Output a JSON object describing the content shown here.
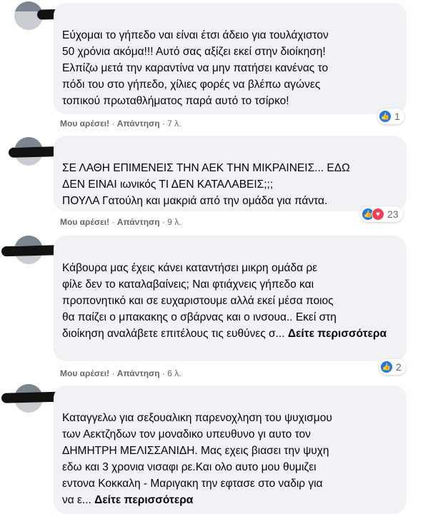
{
  "comments": [
    {
      "text": "Εύχομαι το γήπεδο ναι είναι έτσι άδειο για τουλάχιστον\n50 χρόνια ακόμα!!! Αυτό σας αξίζει εκεί στην διοίκηση!\nΕλπίζω μετά την καραντίνα να μην πατήσει κανένας το\nπόδι του στο γήπεδο, χίλιες φορές να βλέπω αγώνες\nτοπικού πρωταθλήματος παρά αυτό το τσίρκο!",
      "like_label": "Μου αρέσει!",
      "reply_label": "Απάντηση",
      "time": "7 λ.",
      "reaction_count": "1",
      "reactions": [
        "like-icon"
      ]
    },
    {
      "text": "ΣΕ ΛΑΘΗ ΕΠΙΜΕΝΕΙΣ ΤΗΝ ΑΕΚ ΤΗΝ ΜΙΚΡΑΙΝΕΙΣ... ΕΔΩ\nΔΕΝ ΕΙΝΑΙ ιωνικός ΤΙ ΔΕΝ ΚΑΤΑΛΑΒΕΙΣ;;;\nΠΟΥΛΑ Γατούλη και μακριά από την ομάδα για πάντα.",
      "like_label": "Μου αρέσει!",
      "reply_label": "Απάντηση",
      "time": "9 λ.",
      "reaction_count": "23",
      "reactions": [
        "like-icon",
        "love-icon"
      ]
    },
    {
      "text": "Κάβουρα μας έχεις κάνει καταντήσει μικρη ομάδα ρε\nφίλε δεν το καταλαβαίνεις; Ναι φτιάχνεις γήπεδο και\nπροπονητικό και σε ευχαριστουμε αλλά εκεί μέσα ποιος\nθα παίζει ο μπακακης ο σβάρνας και ο ινσουα.. Εκεί στη\nδιοίκηση αναλάβετε επιτέλους τις ευθύνες σ...",
      "see_more": "Δείτε περισσότερα",
      "like_label": "Μου αρέσει!",
      "reply_label": "Απάντηση",
      "time": "6 λ.",
      "reaction_count": "2",
      "reactions": [
        "like-icon"
      ]
    },
    {
      "text": "Καταγγελω για σεξουαλικη παρενοχληση του ψυχισμου\nτων Αεκτζηδων τον μοναδικο υπευθυνο γι αυτο τον\nΔΗΜΗΤΡΗ ΜΕΛΙΣΣΑΝΙΔΗ. Μας εχεις βιασει την ψυχη\nεδω και 3 χρονια νισαφι ρε.Και ολο αυτο μου θυμιζει\nεντονα Κοκκαλη - Μαριγακη την εφτασε στο ναδιρ για\nνα ε...",
      "see_more": "Δείτε περισσότερα"
    }
  ],
  "colors": {
    "bubble": "#f0f2f5",
    "meta": "#65676b",
    "like": "#1877f2",
    "love": "#f33e58"
  }
}
